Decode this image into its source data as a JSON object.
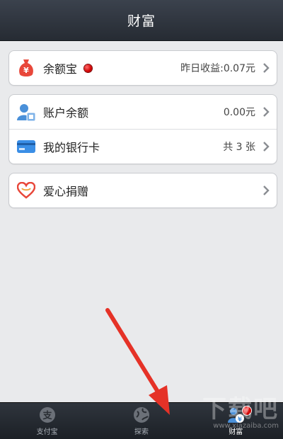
{
  "header": {
    "title": "财富"
  },
  "group1": {
    "yuebao": {
      "label": "余额宝",
      "value": "昨日收益:0.07元",
      "icon": "money-bag-icon"
    }
  },
  "group2": {
    "balance": {
      "label": "账户余额",
      "value": "0.00元",
      "icon": "account-icon"
    },
    "bankcard": {
      "label": "我的银行卡",
      "value": "共 3 张",
      "icon": "bank-card-icon"
    }
  },
  "group3": {
    "donate": {
      "label": "爱心捐赠",
      "icon": "heart-icon"
    }
  },
  "tabbar": {
    "tabs": [
      {
        "label": "支付宝",
        "icon": "alipay-icon"
      },
      {
        "label": "探索",
        "icon": "globe-icon"
      },
      {
        "label": "财富",
        "icon": "wealth-icon",
        "active": true
      }
    ]
  },
  "watermark": {
    "text": "下载吧",
    "url": "www.xiazaiba.com"
  },
  "colors": {
    "accent": "#e8473a",
    "header": "#2e343c",
    "badge": "#d20000"
  }
}
